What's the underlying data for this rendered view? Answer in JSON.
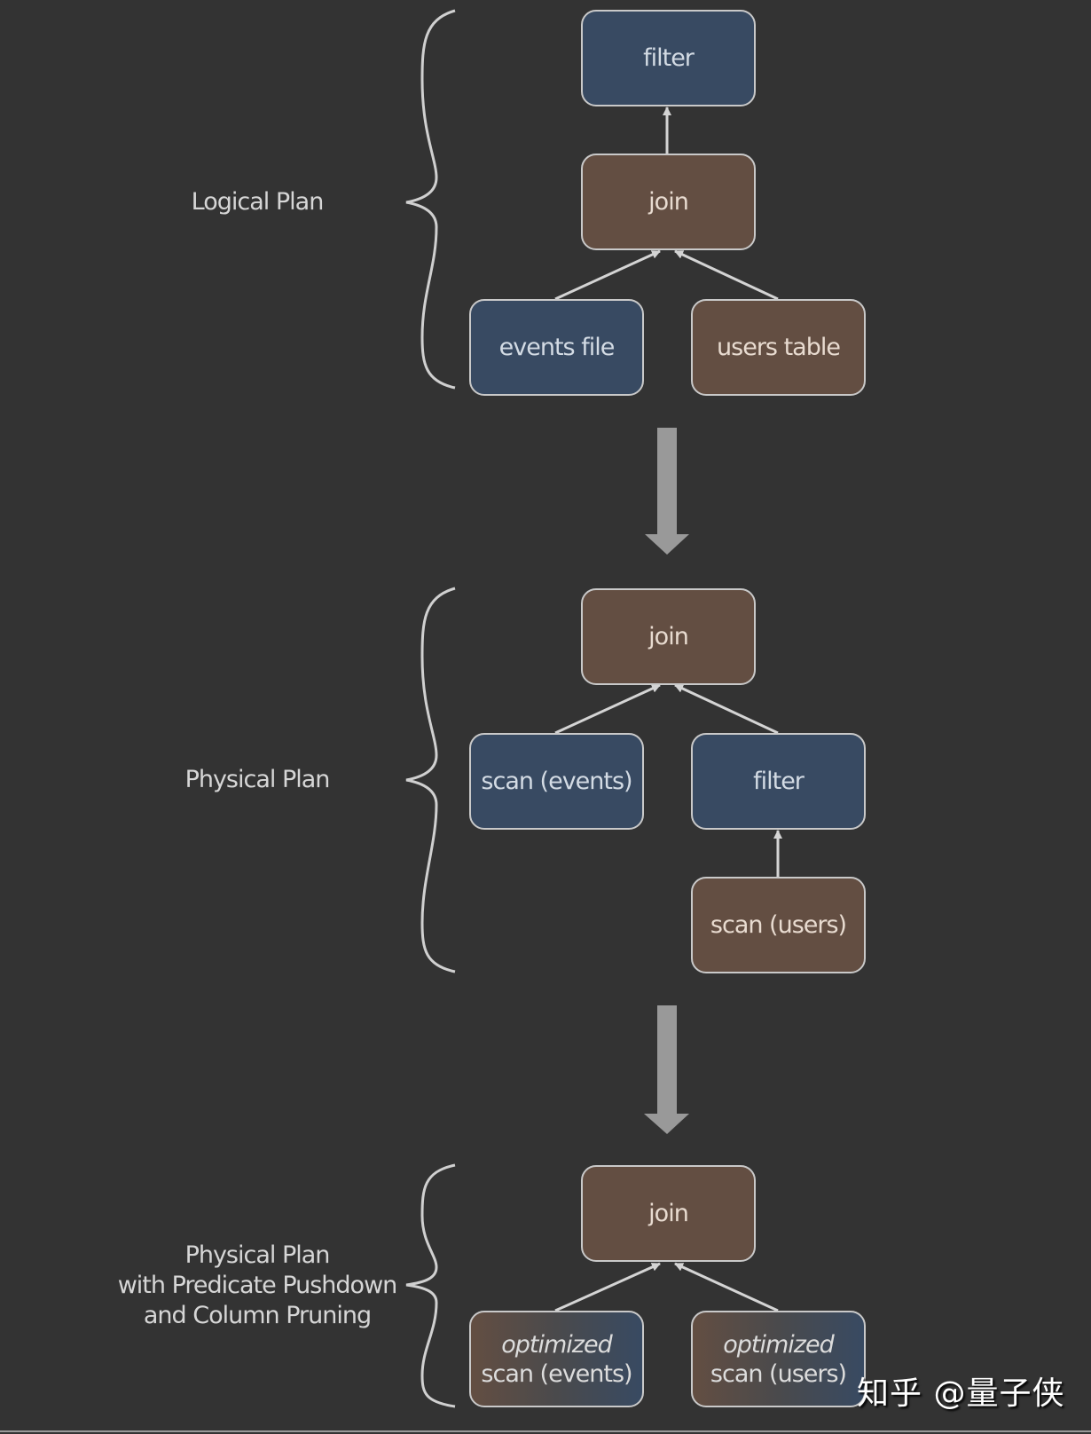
{
  "colors": {
    "background": "#333333",
    "logical_node": "#384a62",
    "physical_node": "#634e42",
    "edge": "#d4d4d4",
    "transition_arrow": "#999999"
  },
  "sections": [
    {
      "label": "Logical Plan",
      "nodes": [
        {
          "id": "l-filter",
          "text": "filter",
          "style": "blue"
        },
        {
          "id": "l-join",
          "text": "join",
          "style": "brown"
        },
        {
          "id": "l-events",
          "text": "events file",
          "style": "blue"
        },
        {
          "id": "l-users",
          "text": "users table",
          "style": "brown"
        }
      ],
      "edges": [
        {
          "from": "l-join",
          "to": "l-filter"
        },
        {
          "from": "l-events",
          "to": "l-join"
        },
        {
          "from": "l-users",
          "to": "l-join"
        }
      ]
    },
    {
      "label": "Physical Plan",
      "nodes": [
        {
          "id": "p-join",
          "text": "join",
          "style": "brown"
        },
        {
          "id": "p-scan-events",
          "text": "scan (events)",
          "style": "blue"
        },
        {
          "id": "p-filter",
          "text": "filter",
          "style": "blue"
        },
        {
          "id": "p-scan-users",
          "text": "scan (users)",
          "style": "brown"
        }
      ],
      "edges": [
        {
          "from": "p-scan-events",
          "to": "p-join"
        },
        {
          "from": "p-filter",
          "to": "p-join"
        },
        {
          "from": "p-scan-users",
          "to": "p-filter"
        }
      ]
    },
    {
      "label_lines": [
        "Physical Plan",
        "with Predicate Pushdown",
        "and Column Pruning"
      ],
      "nodes": [
        {
          "id": "o-join",
          "text": "join",
          "style": "brown"
        },
        {
          "id": "o-scan-events",
          "prefix": "optimized",
          "text": "scan (events)",
          "style": "grad"
        },
        {
          "id": "o-scan-users",
          "prefix": "optimized",
          "text": "scan (users)",
          "style": "grad"
        }
      ],
      "edges": [
        {
          "from": "o-scan-events",
          "to": "o-join"
        },
        {
          "from": "o-scan-users",
          "to": "o-join"
        }
      ]
    }
  ],
  "watermark": "知乎 @量子侠"
}
